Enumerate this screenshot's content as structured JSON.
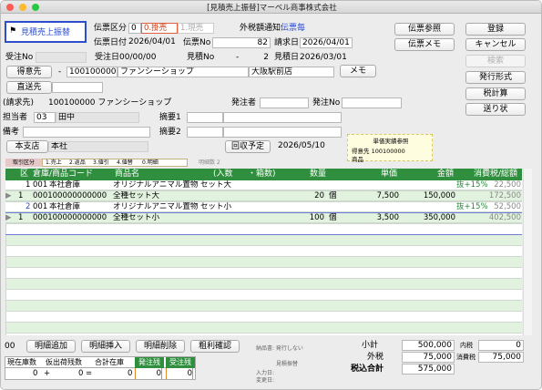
{
  "window": {
    "title": "[見積売上振替]マーベル商事株式会社"
  },
  "mode_button": "見積売上振替",
  "denpyo": {
    "kubun_label": "伝票区分",
    "kubun_val": "0",
    "kubun_opt1": "0.掛売",
    "kubun_opt2": "1.現売",
    "gaika_label": "外税額通知:",
    "gaika_val": "伝票毎",
    "date_label": "伝票日付",
    "date_val": "2026/04/01",
    "no_label": "伝票No",
    "no_val": "82",
    "seikyu_label": "請求日",
    "seikyu_val": "2026/04/01"
  },
  "ukeno": {
    "label": "受注No",
    "ukebi_label": "受注日",
    "ukebi_val": "00/00/00",
    "mitsu_label": "見積No",
    "mitsu_val": "2",
    "mitsubi_label": "見積日",
    "mitsubi_val": "2026/03/01"
  },
  "tokui": {
    "label": "得意先",
    "code": "100100000",
    "name": "ファンシーショップ",
    "branch": "大阪駅前店",
    "memo_btn": "メモ"
  },
  "chokuso": {
    "label": "直送先"
  },
  "seikyu": {
    "label": "(請求先)",
    "val": "100100000 ファンシーショップ",
    "hacchu_label": "発注者",
    "hacchuno_label": "発注No"
  },
  "tanto": {
    "label": "担当者",
    "code": "03",
    "name": "田中",
    "tekiyo1": "摘要1",
    "tekiyo2": "摘要2"
  },
  "biko": {
    "label": "備考"
  },
  "shiten": {
    "label": "本支店",
    "val": "本社",
    "kaishu_btn": "回収予定",
    "kaishu_date": "2026/05/10"
  },
  "tanka_ref": {
    "title": "単価実績参照",
    "tokui": "得意先 100100000",
    "item": "商品"
  },
  "strip": {
    "a": "取引区分",
    "b": "1.売上",
    "c": "2.返品",
    "d": "3.値引",
    "e": "4.値替",
    "f": "0.明細",
    "g": "明細数 2"
  },
  "right_buttons": {
    "ref": "伝票参照",
    "memo": "伝票メモ",
    "reg": "登録",
    "cancel": "キャンセル",
    "search": "検索",
    "hakko": "発行形式",
    "zei": "税計算",
    "okuri": "送り状"
  },
  "grid": {
    "headers": {
      "ku": "区",
      "soko": "倉庫/商品コード",
      "name": "商品名",
      "iri": "(入数",
      "hako": "・箱数)",
      "qty": "数量",
      "tanka": "単価",
      "kin": "金額",
      "tax": "消費税/総額"
    },
    "rows": [
      {
        "line": "1",
        "soko": "001",
        "soko_name": "本社倉庫",
        "name": "オリジナルアニマル置物 セット大",
        "tax_rate": "抜+15%",
        "tax": "22,500",
        "code": "000100000000000",
        "name2": "全種セット大",
        "qty": "20",
        "unit": "個",
        "tanka": "7,500",
        "kin": "150,000",
        "total": "172,500"
      },
      {
        "line": "2",
        "soko": "001",
        "soko_name": "本社倉庫",
        "name": "オリジナルアニマル置物 セット小",
        "tax_rate": "抜+15%",
        "tax": "52,500",
        "code": "000100000000000",
        "name2": "全種セット小",
        "qty": "100",
        "unit": "個",
        "tanka": "3,500",
        "kin": "350,000",
        "total": "402,500"
      }
    ]
  },
  "bottom": {
    "oo": "00",
    "add": "明細追加",
    "ins": "明細挿入",
    "del": "明細削除",
    "arari": "粗利確認",
    "nohin": "納品書: 発行しない",
    "shokei_label": "小計",
    "shokei": "500,000",
    "uchizei_label": "内税",
    "uchizei": "0",
    "gaizei_label": "外税",
    "gaizei": "75,000",
    "shohizei_label": "消費税",
    "shohizei": "75,000",
    "zeikomi_label": "税込合計",
    "zeikomi": "575,000",
    "mitsu_flag": "見積振替",
    "nyuryoku": "入力日:",
    "henko": "変更日:"
  },
  "stock": {
    "h1": "現在庫数",
    "h2": "仮出荷残数",
    "h3": "合計在庫",
    "h4": "発注残",
    "h5": "受注残",
    "v1": "0",
    "op1": "+",
    "v2": "0",
    "op2": "=",
    "v3": "0",
    "v4": "0",
    "v5": "0"
  }
}
